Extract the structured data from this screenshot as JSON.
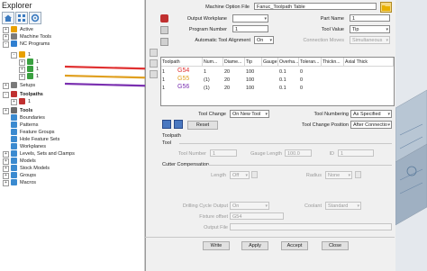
{
  "explorer": {
    "title": "Explorer",
    "tree": [
      {
        "label": "Active",
        "level": 0,
        "expander": "+",
        "color": "#e8a000"
      },
      {
        "label": "Machine Tools",
        "level": 0,
        "expander": "+",
        "color": "#7a7a7a"
      },
      {
        "label": "NC Programs",
        "level": 0,
        "expander": "-",
        "color": "#2f7fd0"
      },
      {
        "label": "1",
        "level": 1,
        "expander": "-",
        "color": "#e8a000"
      },
      {
        "label": "1",
        "level": 2,
        "expander": "+",
        "color": "#3aa040"
      },
      {
        "label": "1",
        "level": 2,
        "expander": "+",
        "color": "#3aa040"
      },
      {
        "label": "1",
        "level": 2,
        "expander": "+",
        "color": "#3aa040"
      },
      {
        "label": "Setups",
        "level": 0,
        "expander": "+",
        "color": "#7a7a7a"
      },
      {
        "label": "Toolpaths",
        "level": 0,
        "expander": "-",
        "color": "#c03030",
        "bold": true
      },
      {
        "label": "1",
        "level": 1,
        "expander": "+",
        "color": "#c03030"
      },
      {
        "label": "Tools",
        "level": 0,
        "expander": "+",
        "color": "#6a6a6a",
        "bold": true
      },
      {
        "label": "Boundaries",
        "level": 0,
        "expander": "",
        "color": "#3a8ad0"
      },
      {
        "label": "Patterns",
        "level": 0,
        "expander": "",
        "color": "#3a8ad0"
      },
      {
        "label": "Feature Groups",
        "level": 0,
        "expander": "",
        "color": "#3a8ad0"
      },
      {
        "label": "Hole Feature Sets",
        "level": 0,
        "expander": "",
        "color": "#3a8ad0"
      },
      {
        "label": "Workplanes",
        "level": 0,
        "expander": "",
        "color": "#3a8ad0"
      },
      {
        "label": "Levels, Sets and Clamps",
        "level": 0,
        "expander": "+",
        "color": "#3a8ad0"
      },
      {
        "label": "Models",
        "level": 0,
        "expander": "+",
        "color": "#3a8ad0"
      },
      {
        "label": "Stock Models",
        "level": 0,
        "expander": "+",
        "color": "#3a8ad0"
      },
      {
        "label": "Groups",
        "level": 0,
        "expander": "+",
        "color": "#3a8ad0"
      },
      {
        "label": "Macros",
        "level": 0,
        "expander": "+",
        "color": "#3a8ad0"
      }
    ]
  },
  "dialog": {
    "machine_option_file_label": "Machine Option File",
    "machine_option_file_value": "Fanuc_Toolpath Table",
    "output_workplane_label": "Output Workplane",
    "part_name_label": "Part Name",
    "part_name_value": "1",
    "program_number_label": "Program Number",
    "program_number_value": "1",
    "tool_value_label": "Tool Value",
    "tool_value_value": "Tip",
    "auto_tool_align_label": "Automatic Tool Alignment",
    "auto_tool_align_value": "On",
    "connection_moves_label": "Connection Moves",
    "connection_moves_value": "Simultaneous",
    "table": {
      "headers": [
        "Toolpath",
        "Num...",
        "Diame...",
        "Tip",
        "Gauge",
        "Overha...",
        "Toleran...",
        "Thickn...",
        "Axial Thick"
      ],
      "rows": [
        [
          "1",
          "1",
          "20",
          "100",
          "",
          "0.1",
          "0",
          "",
          ""
        ],
        [
          "1",
          "(1)",
          "20",
          "100",
          "",
          "0.1",
          "0",
          "",
          ""
        ],
        [
          "1",
          "(1)",
          "20",
          "100",
          "",
          "0.1",
          "0",
          "",
          ""
        ]
      ],
      "annotations": [
        {
          "text": "G54",
          "color": "#e03030"
        },
        {
          "text": "G55",
          "color": "#e0a020"
        },
        {
          "text": "G56",
          "color": "#7a30b0"
        }
      ]
    },
    "tool_change_label": "Tool Change",
    "tool_change_value": "On New Tool",
    "tool_numbering_label": "Tool Numbering",
    "tool_numbering_value": "As Specified",
    "reset_label": "Reset",
    "tool_change_position_label": "Tool Change Position",
    "tool_change_position_value": "After Connectio",
    "toolpath_section": "Toolpath",
    "tool_section": "Tool",
    "tool_number_label": "Tool Number",
    "tool_number_value": "1",
    "gauge_length_label": "Gauge Length",
    "gauge_length_value": "100.0",
    "id_label": "ID",
    "id_value": "1",
    "cutter_comp_section": "Cutter Compensation",
    "length_label": "Length",
    "length_value": "Off",
    "radius_label": "Radius",
    "radius_value": "None",
    "drilling_cycle_label": "Drilling Cycle Output",
    "drilling_cycle_value": "On",
    "coolant_label": "Coolant",
    "coolant_value": "Standard",
    "fixture_offset_label": "Fixture offset",
    "fixture_offset_value": "G54",
    "output_file_label": "Output File",
    "buttons": {
      "write": "Write",
      "apply": "Apply",
      "accept": "Accept",
      "close": "Close"
    }
  },
  "colors": {
    "arrow_red": "#e03030",
    "arrow_orange": "#e0a020",
    "arrow_purple": "#7a30b0",
    "toolpath_icon": "#c03030",
    "folder_icon": "#e8b000"
  }
}
